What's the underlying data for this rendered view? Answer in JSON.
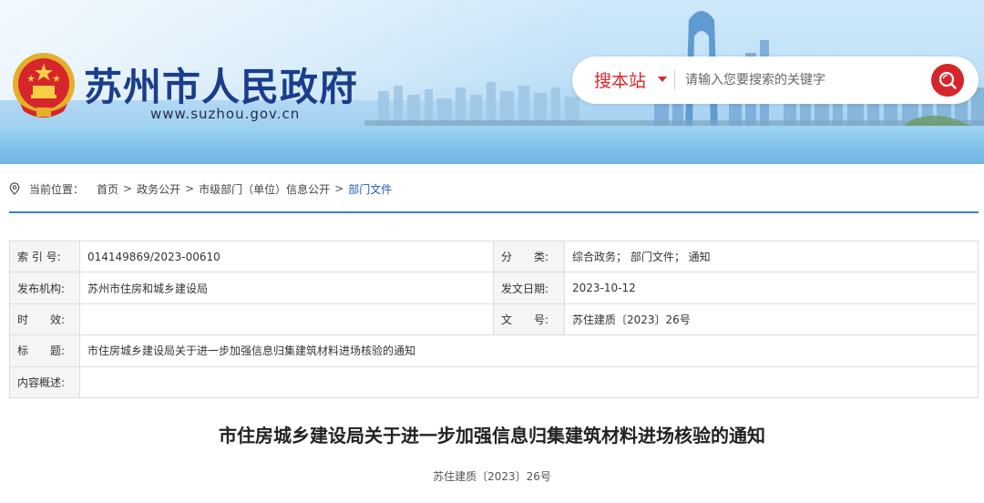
{
  "header": {
    "site_title": "苏州市人民政府",
    "site_url": "www.suzhou.gov.cn",
    "search_scope": "搜本站",
    "search_placeholder": "请输入您要搜索的关键字",
    "icons": {
      "emblem": "national-emblem-icon",
      "search": "search-icon",
      "scope": "caret-down-icon"
    },
    "colors": {
      "title": "#1a3e8c",
      "accent_red": "#d6262b"
    }
  },
  "breadcrumb": {
    "label": "当前位置：",
    "icon": "location-pin-icon",
    "items": [
      "首页",
      "政务公开",
      "市级部门（单位）信息公开",
      "部门文件"
    ],
    "separator": ">",
    "colors": {
      "current": "#1e5bb8",
      "rule": "#3a7ed2"
    }
  },
  "info": {
    "index_label": "索 引 号:",
    "index_value": "014149869/2023-00610",
    "category_label": "分　　类:",
    "category_value": "综合政务； 部门文件； 通知",
    "publisher_label": "发布机构:",
    "publisher_value": "苏州市住房和城乡建设局",
    "date_label": "发文日期:",
    "date_value": "2023-10-12",
    "validity_label": "时　　效:",
    "validity_value": "",
    "docno_label": "文　　号:",
    "docno_value": "苏住建质〔2023〕26号",
    "title_label": "标　　题:",
    "title_value": "市住房城乡建设局关于进一步加强信息归集建筑材料进场核验的通知",
    "summary_label": "内容概述:",
    "summary_value": ""
  },
  "article": {
    "title": "市住房城乡建设局关于进一步加强信息归集建筑材料进场核验的通知",
    "doc_number": "苏住建质〔2023〕26号"
  }
}
